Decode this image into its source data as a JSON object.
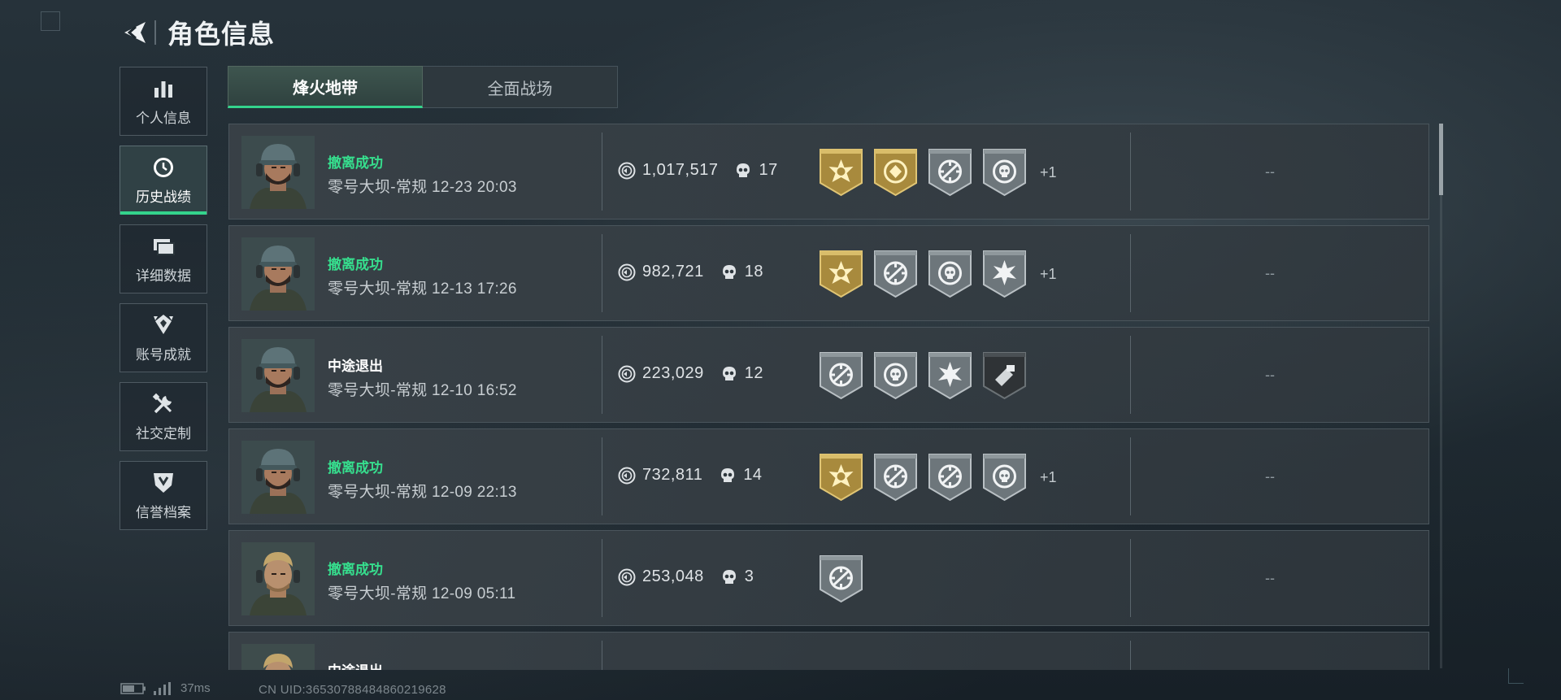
{
  "header": {
    "title": "角色信息"
  },
  "sidebar": {
    "items": [
      {
        "label": "个人信息",
        "icon": "bar-chart-icon"
      },
      {
        "label": "历史战绩",
        "icon": "clock-icon",
        "active": true
      },
      {
        "label": "详细数据",
        "icon": "cards-icon"
      },
      {
        "label": "账号成就",
        "icon": "achievement-icon"
      },
      {
        "label": "社交定制",
        "icon": "tools-icon"
      },
      {
        "label": "信誉档案",
        "icon": "shield-icon"
      }
    ]
  },
  "tabs": [
    {
      "label": "烽火地带",
      "active": true
    },
    {
      "label": "全面战场",
      "active": false
    }
  ],
  "records": [
    {
      "status": "撤离成功",
      "status_type": "success",
      "map": "零号大坝-常规",
      "time": "12-23 20:03",
      "value": "1,017,517",
      "kills": "17",
      "extra_badges": "+1",
      "extra": "--"
    },
    {
      "status": "撤离成功",
      "status_type": "success",
      "map": "零号大坝-常规",
      "time": "12-13 17:26",
      "value": "982,721",
      "kills": "18",
      "extra_badges": "+1",
      "extra": "--"
    },
    {
      "status": "中途退出",
      "status_type": "quit",
      "map": "零号大坝-常规",
      "time": "12-10 16:52",
      "value": "223,029",
      "kills": "12",
      "extra_badges": "",
      "extra": "--"
    },
    {
      "status": "撤离成功",
      "status_type": "success",
      "map": "零号大坝-常规",
      "time": "12-09 22:13",
      "value": "732,811",
      "kills": "14",
      "extra_badges": "+1",
      "extra": "--"
    },
    {
      "status": "撤离成功",
      "status_type": "success",
      "map": "零号大坝-常规",
      "time": "12-09 05:11",
      "value": "253,048",
      "kills": "3",
      "extra_badges": "",
      "extra": "--"
    },
    {
      "status": "中途退出",
      "status_type": "quit",
      "map": "",
      "time": "",
      "value": "",
      "kills": "",
      "extra_badges": "",
      "extra": ""
    }
  ],
  "footer": {
    "ping": "37ms",
    "uid": "CN UID:3653078848486021962​8"
  },
  "colors": {
    "accent": "#34d38c",
    "gold_badge": "#b89a45",
    "gray_badge": "#7a8388"
  }
}
